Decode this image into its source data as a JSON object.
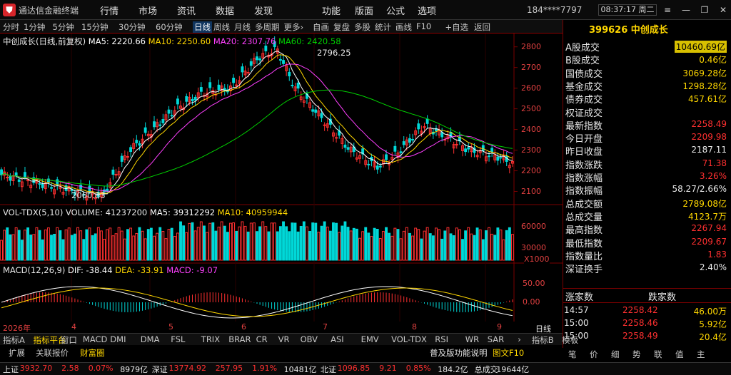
{
  "window": {
    "app_title": "通达信金融终端",
    "user_id": "184****7797",
    "clock": "08:37:17 周二",
    "menu": [
      "行情",
      "市场",
      "资讯",
      "数据",
      "发现",
      "功能",
      "版面",
      "公式",
      "选项"
    ],
    "win_buttons": [
      "≡",
      "—",
      "❐",
      "✕"
    ]
  },
  "toolbar": {
    "items": [
      "分时",
      "1分钟",
      "5分钟",
      "15分钟",
      "30分钟",
      "60分钟",
      "日线",
      "周线",
      "月线",
      "多周期",
      "更多›",
      "自画",
      "复盘",
      "多股",
      "统计",
      "画线",
      "F10",
      "+自选",
      "返回"
    ],
    "active": "日线"
  },
  "chart": {
    "title_ma": {
      "name": "中创成长(日线,前复权)",
      "ma5": "MA5: 2220.66",
      "ma10": "MA10: 2250.60",
      "ma20": "MA20: 2307.76",
      "ma60": "MA60: 2420.58"
    },
    "high_label": "2796.25",
    "low_label": "2060.83",
    "price_ticks": [
      "2800",
      "2700",
      "2600",
      "2500",
      "2400",
      "2300",
      "2200",
      "2100"
    ],
    "vol_title": {
      "name": "VOL-TDX(5,10)",
      "volume": "VOLUME: 41237200",
      "ma5": "MA5: 39312292",
      "ma10": "MA10: 40959944"
    },
    "vol_ticks": [
      "60000",
      "30000"
    ],
    "vol_unit": "X1000",
    "macd_title": {
      "name": "MACD(12,26,9)",
      "dif": "DIF: -38.44",
      "dea": "DEA: -33.91",
      "macd": "MACD: -9.07"
    },
    "macd_ticks": [
      "50.00",
      "0.00"
    ],
    "date_labels": [
      "2026年",
      "4",
      "5",
      "6",
      "7",
      "8",
      "9"
    ],
    "period_label": "日线"
  },
  "info": {
    "index_code_name": "399626 中创成长",
    "rows": [
      {
        "label": "A股成交",
        "value": "10460.69亿",
        "color": "#ffd700",
        "box": true
      },
      {
        "label": "B股成交",
        "value": "0.46亿",
        "color": "#ffd700",
        "box": false
      },
      {
        "label": "国债成交",
        "value": "3069.28亿",
        "color": "#ffd700",
        "box": false
      },
      {
        "label": "基金成交",
        "value": "1298.28亿",
        "color": "#ffd700",
        "box": false
      },
      {
        "label": "债券成交",
        "value": "457.61亿",
        "color": "#ffd700",
        "box": false
      },
      {
        "label": "权证成交",
        "value": "",
        "color": "#ffd700",
        "box": false
      },
      {
        "label": "最新指数",
        "value": "2258.49",
        "color": "#ff3030",
        "box": false
      },
      {
        "label": "今日开盘",
        "value": "2209.98",
        "color": "#ff3030",
        "box": false
      },
      {
        "label": "昨日收盘",
        "value": "2187.11",
        "color": "#e8e8e8",
        "box": false
      },
      {
        "label": "指数涨跌",
        "value": "71.38",
        "color": "#ff3030",
        "box": false
      },
      {
        "label": "指数涨幅",
        "value": "3.26%",
        "color": "#ff3030",
        "box": false
      },
      {
        "label": "指数振幅",
        "value": "58.27/2.66%",
        "color": "#e8e8e8",
        "box": false
      },
      {
        "label": "总成交额",
        "value": "2789.08亿",
        "color": "#ffd700",
        "box": false
      },
      {
        "label": "总成交量",
        "value": "4123.7万",
        "color": "#ffd700",
        "box": false
      },
      {
        "label": "最高指数",
        "value": "2267.94",
        "color": "#ff3030",
        "box": false
      },
      {
        "label": "最低指数",
        "value": "2209.67",
        "color": "#ff3030",
        "box": false
      },
      {
        "label": "指数量比",
        "value": "1.83",
        "color": "#ff3030",
        "box": false
      },
      {
        "label": "深证换手",
        "value": "2.40%",
        "color": "#e8e8e8",
        "box": false
      }
    ],
    "updown_header": [
      "涨家数",
      "跌家数"
    ],
    "ticks": [
      {
        "time": "14:57",
        "price": "2258.42",
        "vol": "46.00万"
      },
      {
        "time": "15:00",
        "price": "2258.46",
        "vol": "5.92亿"
      },
      {
        "time": "15:00",
        "price": "2258.49",
        "vol": "20.4亿"
      }
    ],
    "right_tabs": [
      "笔",
      "价",
      "细",
      "势",
      "联",
      "值",
      "主"
    ]
  },
  "indicator_tabs": {
    "items": [
      "指标A",
      "指标平台",
      "窗口",
      "MACD",
      "DMI",
      "DMA",
      "FSL",
      "TRIX",
      "BRAR",
      "CR",
      "VR",
      "OBV",
      "ASI",
      "EMV",
      "VOL-TDX",
      "RSI",
      "WR",
      "SAR",
      "›",
      "指标B",
      "模板"
    ],
    "active": "指标平台",
    "sub_items": [
      "扩展",
      "关联报价",
      "财富圈"
    ],
    "sub_active": "财富圈",
    "news_ticker": "普及版功能说明",
    "f10_label": "图文F10"
  },
  "status": {
    "items": [
      {
        "text": "上证",
        "color": "#e8e8e8"
      },
      {
        "text": "3932.70",
        "color": "#ff3030"
      },
      {
        "text": "2.58",
        "color": "#ff3030"
      },
      {
        "text": "0.07%",
        "color": "#ff3030"
      },
      {
        "text": "8979亿",
        "color": "#e8e8e8"
      },
      {
        "text": "深证",
        "color": "#e8e8e8"
      },
      {
        "text": "13774.92",
        "color": "#ff3030"
      },
      {
        "text": "257.95",
        "color": "#ff3030"
      },
      {
        "text": "1.91%",
        "color": "#ff3030"
      },
      {
        "text": "10481亿",
        "color": "#e8e8e8"
      },
      {
        "text": "北证",
        "color": "#e8e8e8"
      },
      {
        "text": "1096.85",
        "color": "#ff3030"
      },
      {
        "text": "9.21",
        "color": "#ff3030"
      },
      {
        "text": "0.85%",
        "color": "#ff3030"
      },
      {
        "text": "184.2亿",
        "color": "#e8e8e8"
      },
      {
        "text": "总成交",
        "color": "#e8e8e8"
      },
      {
        "text": "19644亿",
        "color": "#e8e8e8"
      }
    ]
  },
  "colors": {
    "up": "#ff3030",
    "down": "#00d8d8",
    "ma5": "#ffffff",
    "ma10": "#ffd700",
    "ma20": "#ff40ff",
    "ma60": "#00d000",
    "grid": "#7a0000"
  }
}
